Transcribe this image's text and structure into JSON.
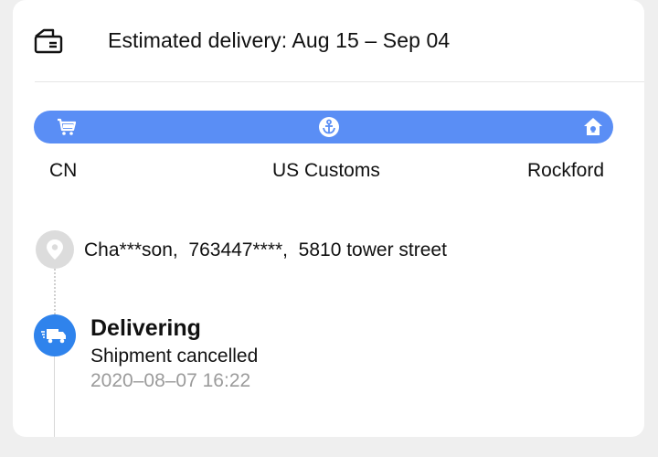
{
  "estimate": {
    "icon": "truck-outline-icon",
    "text": "Estimated delivery: Aug 15 – Sep 04"
  },
  "progress": {
    "bar_color": "#5a8ef5",
    "icons": [
      "cart-icon",
      "anchor-icon",
      "home-icon"
    ],
    "stages": [
      "CN",
      "US Customs",
      "Rockford"
    ]
  },
  "address": {
    "icon": "location-pin-icon",
    "text": "Cha***son,  763447****,  5810 tower street"
  },
  "tracking": {
    "icon": "delivery-truck-icon",
    "icon_color": "#2f83ec",
    "status": "Delivering",
    "description": "Shipment cancelled",
    "time": "2020–08–07 16:22"
  }
}
